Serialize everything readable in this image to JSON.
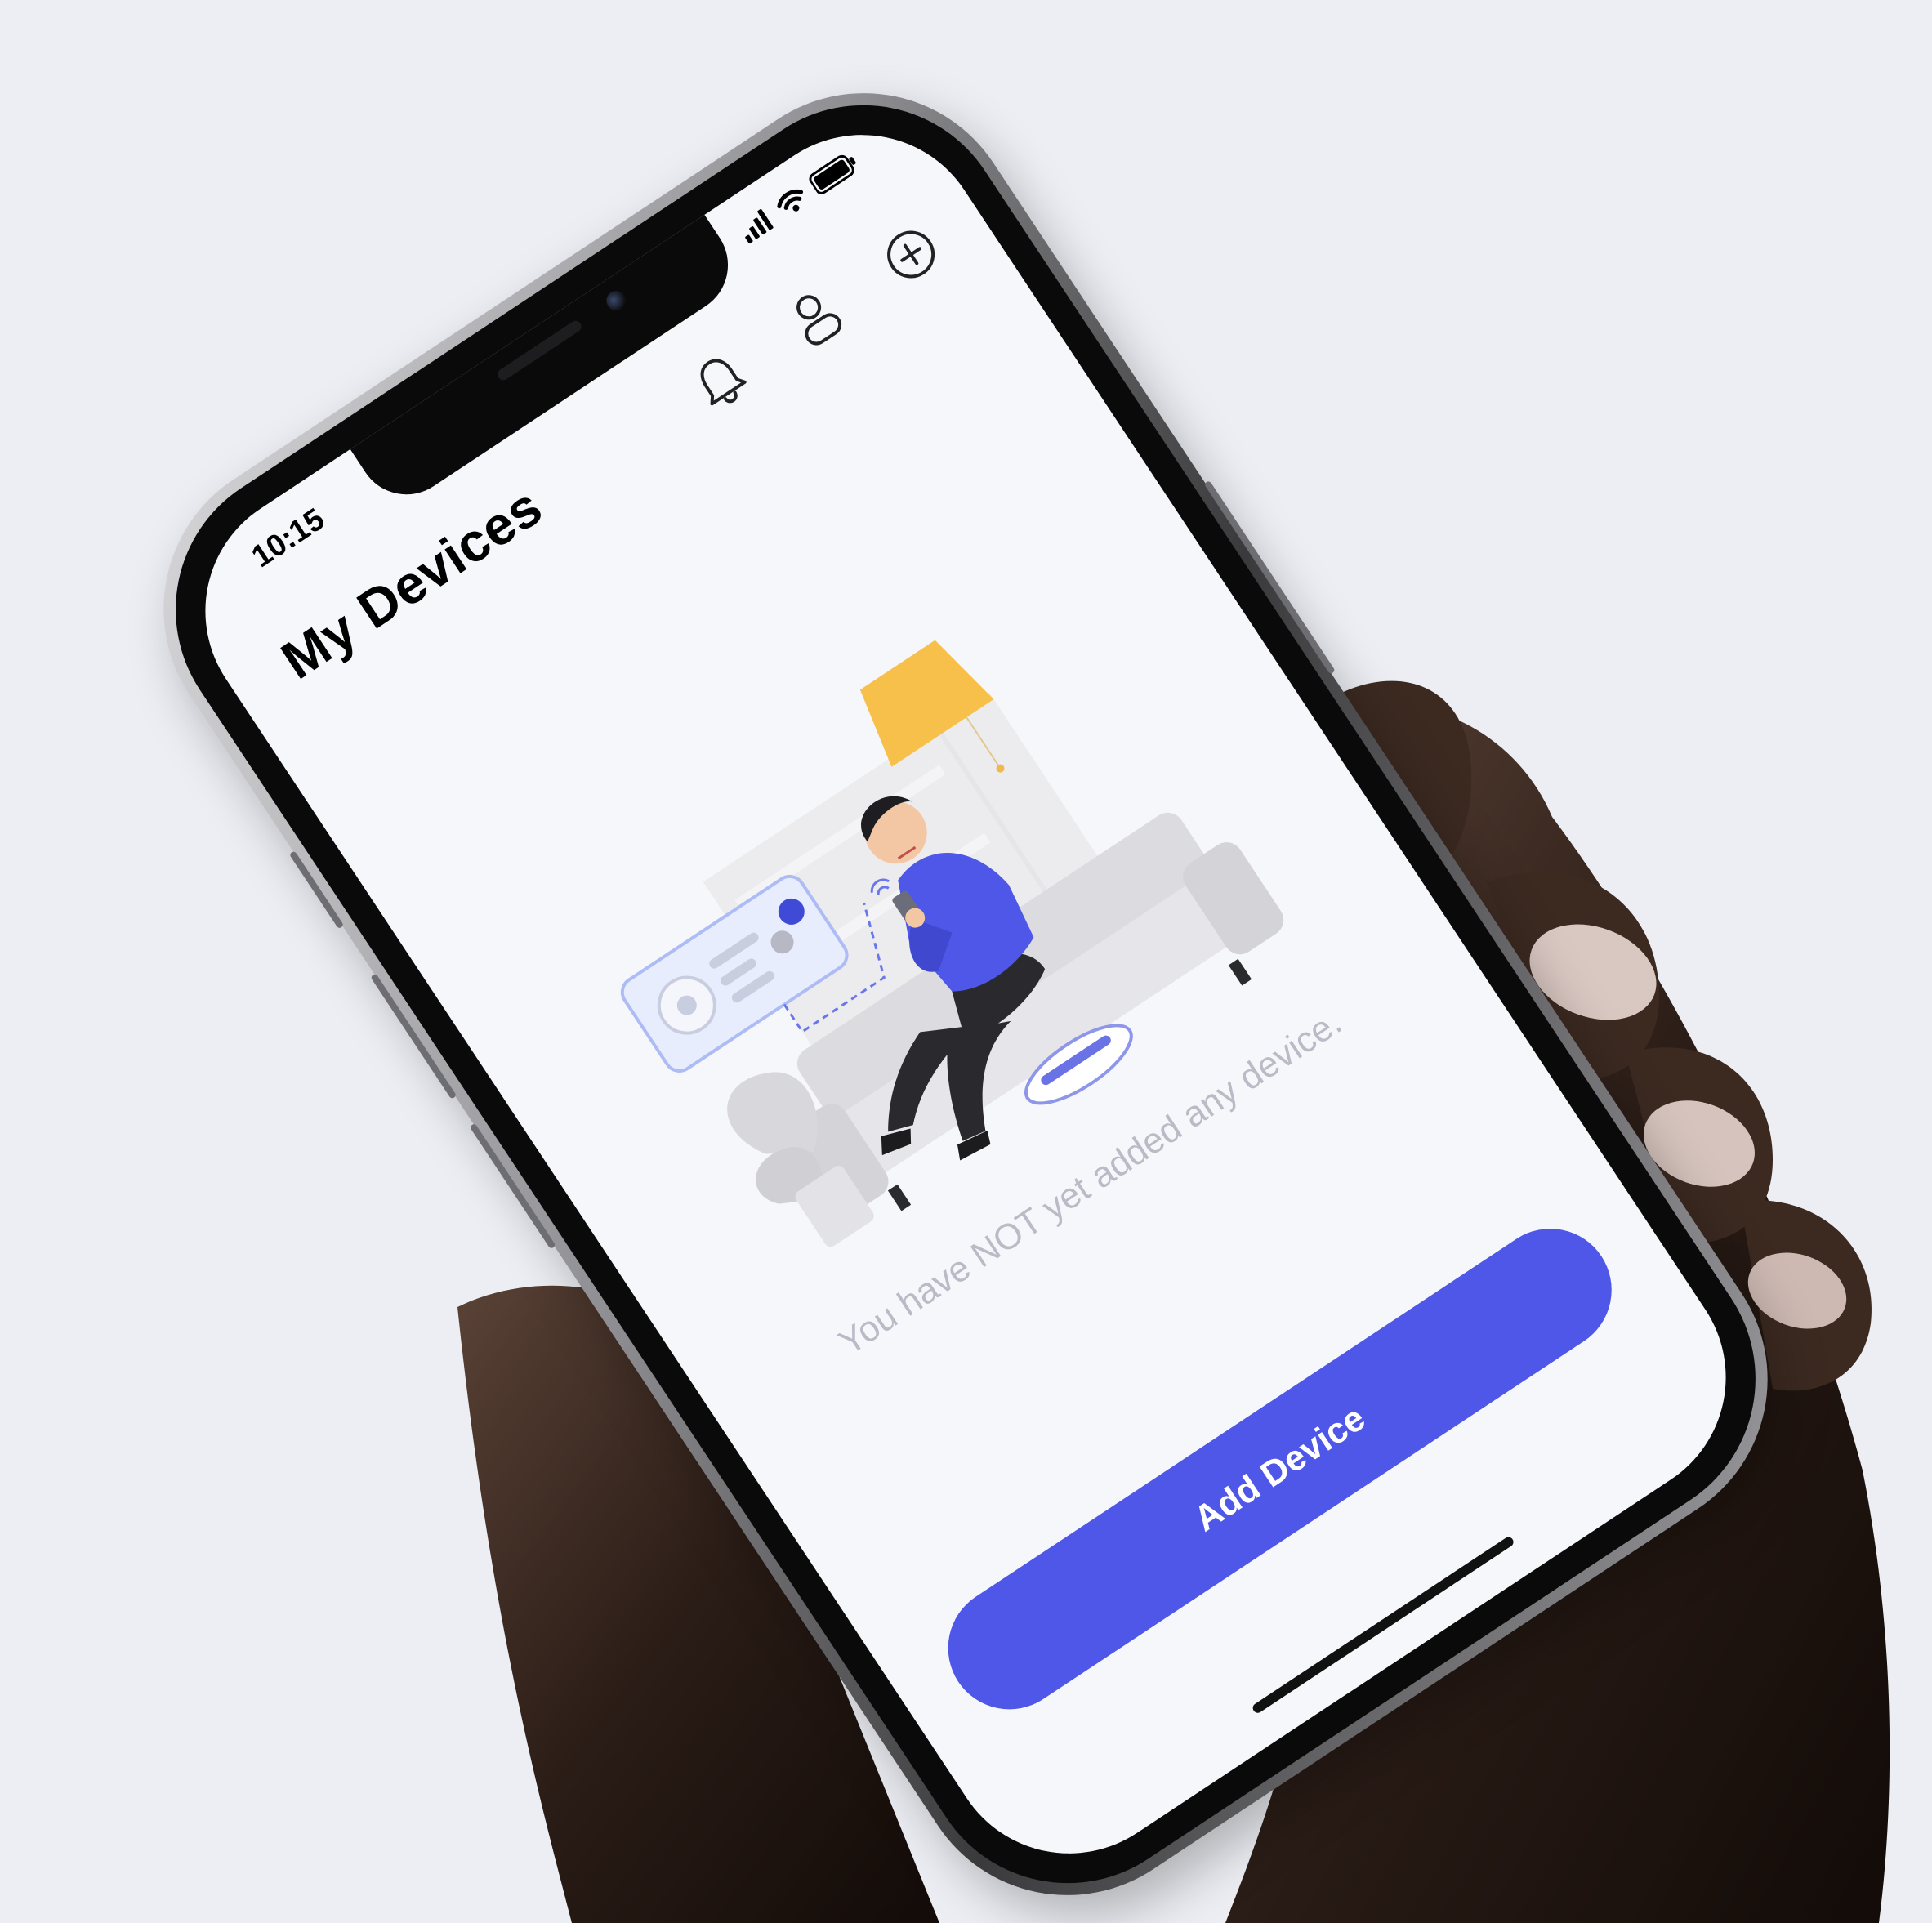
{
  "status_bar": {
    "time": "10:15"
  },
  "header": {
    "title": "My Devices",
    "icons": [
      "bell-icon",
      "profile-icon",
      "add-circle-icon"
    ]
  },
  "empty_state": {
    "message": "You have NOT yet added any device."
  },
  "actions": {
    "add_device_label": "Add Device"
  },
  "colors": {
    "accent": "#4e57e8",
    "screen_background": "#f6f7fb",
    "muted_text": "#b9bcc6",
    "lamp": "#f7c04a",
    "character_shirt": "#4e57e8"
  }
}
